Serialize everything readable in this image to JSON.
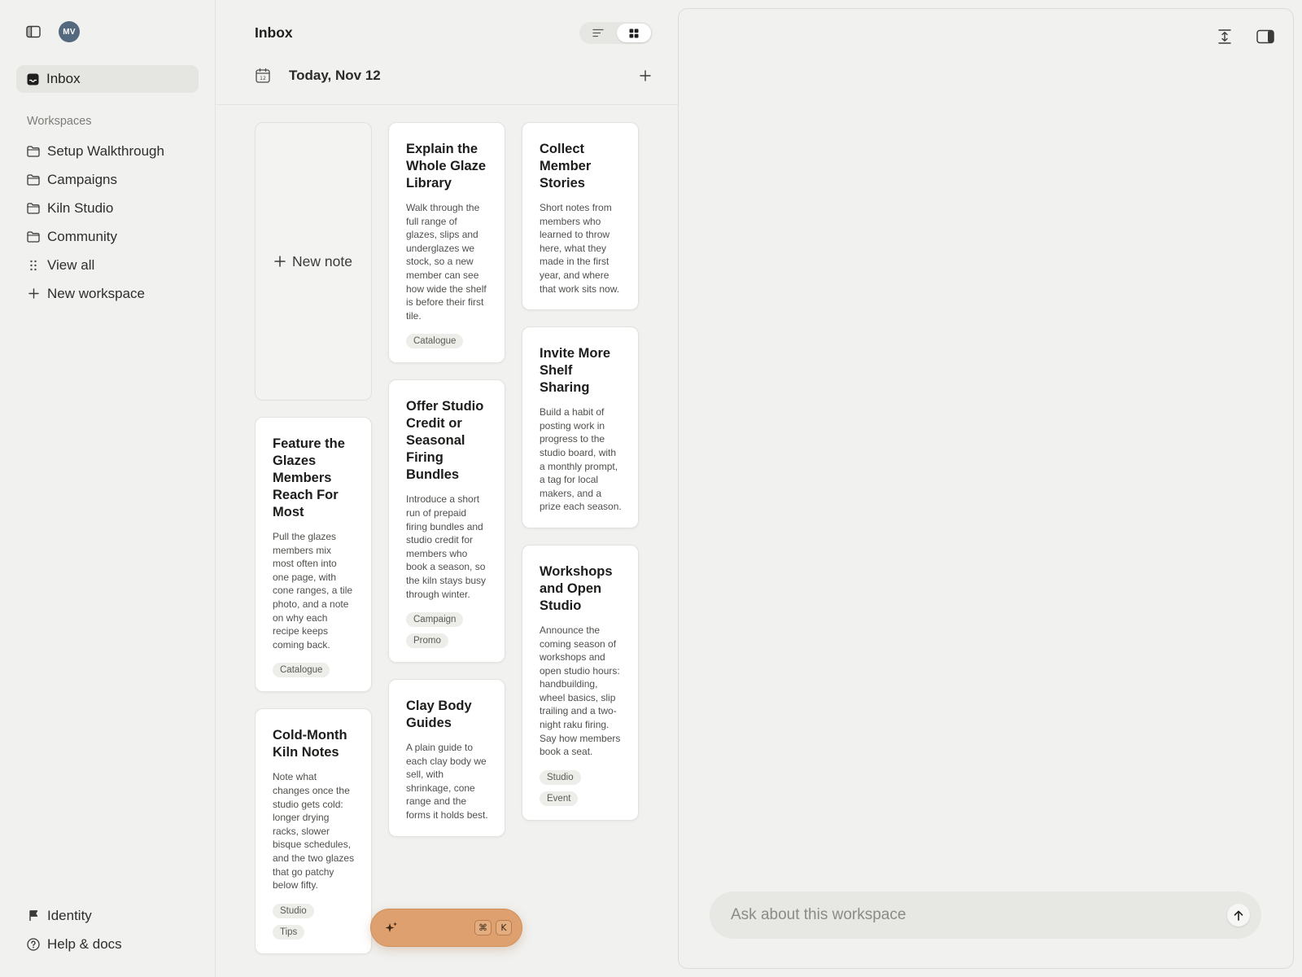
{
  "sidebar": {
    "avatar_initials": "MV",
    "inbox_label": "Inbox",
    "workspaces_heading": "Workspaces",
    "workspaces": [
      {
        "label": "Setup Walkthrough",
        "icon": "folder-icon"
      },
      {
        "label": "Campaigns",
        "icon": "folder-icon"
      },
      {
        "label": "Kiln Studio",
        "icon": "folder-icon"
      },
      {
        "label": "Community",
        "icon": "folder-icon"
      }
    ],
    "view_all_label": "View all",
    "new_workspace_label": "New workspace",
    "bottom": [
      {
        "label": "Identity",
        "icon": "flag-icon"
      },
      {
        "label": "Help & docs",
        "icon": "help-circle-icon"
      }
    ]
  },
  "main": {
    "title": "Inbox",
    "date_label": "Today, Nov 12",
    "calendar_day": "12",
    "new_note_label": "New note",
    "cards": [
      {
        "title": "Feature the Glazes Members Reach For Most",
        "body": "Pull the glazes members mix most often into one page, with cone ranges, a tile photo, and a note on why each recipe keeps coming back.",
        "tags": [
          "Catalogue"
        ]
      },
      {
        "title": "Cold-Month Kiln Notes",
        "body": "Note what changes once the studio gets cold: longer drying racks, slower bisque schedules, and the two glazes that go patchy below fifty.",
        "tags": [
          "Studio",
          "Tips"
        ]
      },
      {
        "title": "Explain the Whole Glaze Library",
        "body": "Walk through the full range of glazes, slips and underglazes we stock, so a new member can see how wide the shelf is before their first tile.",
        "tags": [
          "Catalogue"
        ]
      },
      {
        "title": "Offer Studio Credit or Seasonal Firing Bundles",
        "body": "Introduce a short run of prepaid firing bundles and studio credit for members who book a season, so the kiln stays busy through winter.",
        "tags": [
          "Campaign",
          "Promo"
        ]
      },
      {
        "title": "Clay Body Guides",
        "body": "A plain guide to each clay body we sell, with shrinkage, cone range and the forms it holds best.",
        "tags": []
      },
      {
        "title": "Collect Member Stories",
        "body": "Short notes from members who learned to throw here, what they made in the first year, and where that work sits now.",
        "tags": []
      },
      {
        "title": "Invite More Shelf Sharing",
        "body": "Build a habit of posting work in progress to the studio board, with a monthly prompt, a tag for local makers, and a prize each season.",
        "tags": []
      },
      {
        "title": "Workshops and Open Studio",
        "body": "Announce the coming season of workshops and open studio hours: handbuilding, wheel basics, slip trailing and a two-night raku firing. Say how members book a seat.",
        "tags": [
          "Studio",
          "Event"
        ]
      }
    ],
    "ai_button": {
      "icon": "sparkle-icon",
      "shortcut": [
        "⌘",
        "K"
      ]
    }
  },
  "panel": {
    "ask_placeholder": "Ask about this workspace"
  },
  "colors": {
    "background": "#f1f1ef",
    "accent": "#dda06e",
    "avatar": "#54697d"
  }
}
